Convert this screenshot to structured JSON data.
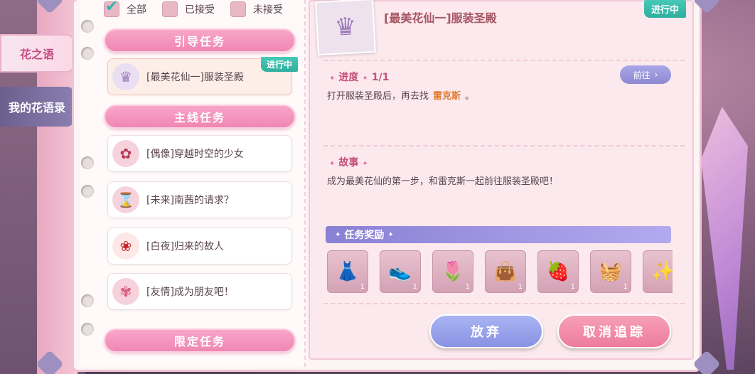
{
  "sidebar": {
    "tabs": [
      {
        "label": "花之语"
      },
      {
        "label": "我的花语录"
      }
    ]
  },
  "filters": [
    {
      "label": "全部",
      "checked": true
    },
    {
      "label": "已接受",
      "checked": false
    },
    {
      "label": "未接受",
      "checked": false
    }
  ],
  "sections": {
    "guide": "引导任务",
    "main": "主线任务",
    "limited": "限定任务"
  },
  "tasks": {
    "guide": [
      {
        "title": "[最美花仙一]服装圣殿",
        "badge": "进行中",
        "icon": "crown-icon"
      }
    ],
    "main": [
      {
        "title": "[偶像]穿越时空的少女",
        "icon": "flower-icon"
      },
      {
        "title": "[未来]南茜的请求？",
        "icon": "hourglass-icon"
      },
      {
        "title": "[白夜]归来的故人",
        "icon": "red-flower-icon"
      },
      {
        "title": "[友情]成为朋友吧！",
        "icon": "pink-flower-icon"
      }
    ]
  },
  "detail": {
    "title": "[最美花仙一]服装圣殿",
    "badge": "进行中",
    "progress_label": "进度",
    "progress_value": "1/1",
    "progress_text_before": "打开服装圣殿后，再去找",
    "progress_highlight": "雷克斯",
    "progress_text_after": "。",
    "goto_label": "前往",
    "story_label": "故事",
    "story_text": "成为最美花仙的第一步，和雷克斯一起前往服装圣殿吧！",
    "rewards_label": "任务奖励",
    "rewards": [
      {
        "icon": "dress-icon",
        "qty": "1"
      },
      {
        "icon": "shoes-icon",
        "qty": "1"
      },
      {
        "icon": "tulip-icon",
        "qty": "1"
      },
      {
        "icon": "bag-icon",
        "qty": "1"
      },
      {
        "icon": "strawberry-icon",
        "qty": "1"
      },
      {
        "icon": "basket-icon",
        "qty": "1"
      },
      {
        "icon": "sparkle-icon",
        "qty": ""
      }
    ]
  },
  "buttons": {
    "abandon": "放弃",
    "untrack": "取消追踪"
  },
  "colors": {
    "accent_pink": "#ef86b4",
    "teal_badge": "#2fae9e",
    "purple": "#8a80d4",
    "highlight": "#e27a2a"
  }
}
